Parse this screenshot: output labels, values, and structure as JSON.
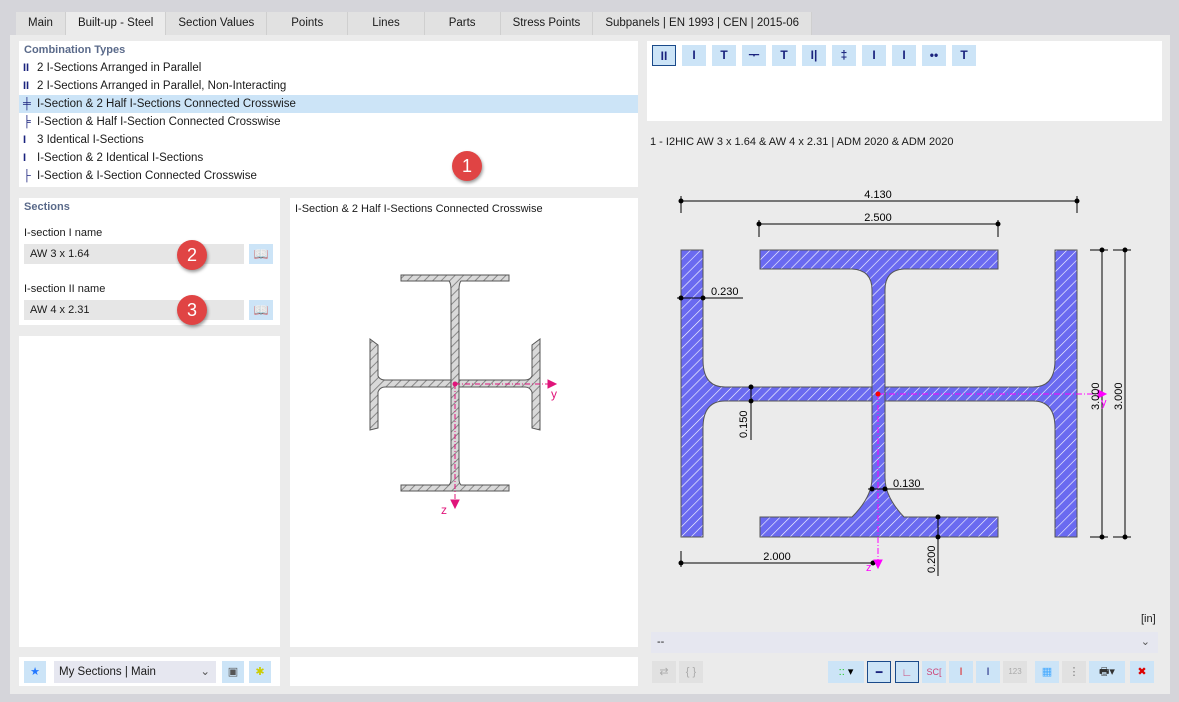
{
  "tabs": [
    "Main",
    "Built-up - Steel",
    "Section Values",
    "Points",
    "Lines",
    "Parts",
    "Stress Points",
    "Subpanels | EN 1993 | CEN | 2015-06"
  ],
  "active_tab": 1,
  "combination_types": {
    "title": "Combination Types",
    "items": [
      {
        "icon": "two-i-parallel-icon",
        "glyph": "II",
        "label": "2 I-Sections Arranged in Parallel"
      },
      {
        "icon": "two-i-parallel-noninteracting-icon",
        "glyph": "II",
        "label": "2 I-Sections Arranged in Parallel, Non-Interacting"
      },
      {
        "icon": "i-two-half-crosswise-icon",
        "glyph": "╪",
        "label": "I-Section & 2 Half I-Sections Connected Crosswise",
        "selected": true
      },
      {
        "icon": "i-half-crosswise-icon",
        "glyph": "╞",
        "label": "I-Section & Half I-Section Connected Crosswise"
      },
      {
        "icon": "three-identical-i-icon",
        "glyph": "I",
        "label": "3 Identical I-Sections"
      },
      {
        "icon": "i-two-identical-i-icon",
        "glyph": "I",
        "label": "I-Section & 2 Identical I-Sections"
      },
      {
        "icon": "i-i-crosswise-icon",
        "glyph": "├",
        "label": "I-Section & I-Section Connected Crosswise"
      }
    ]
  },
  "badges": [
    "1",
    "2",
    "3"
  ],
  "sections": {
    "title": "Sections",
    "section1_label": "I-section I name",
    "section1_value": "AW 3 x 1.64",
    "section2_label": "I-section II name",
    "section2_value": "AW 4 x 2.31"
  },
  "preview": {
    "title": "I-Section & 2 Half I-Sections Connected Crosswise",
    "axis_y": "y",
    "axis_z": "z"
  },
  "shape_toolbar": [
    {
      "icon": "double-i-icon",
      "glyph": "II",
      "selected": true
    },
    {
      "icon": "i-section-icon",
      "glyph": "I"
    },
    {
      "icon": "i-top-plate-icon",
      "glyph": "T"
    },
    {
      "icon": "half-t-icon",
      "glyph": "ᅮ"
    },
    {
      "icon": "double-t-icon",
      "glyph": "T"
    },
    {
      "icon": "i-plate-side-icon",
      "glyph": "I|"
    },
    {
      "icon": "i-cross-icon",
      "glyph": "‡"
    },
    {
      "icon": "i-narrow-icon",
      "glyph": "I"
    },
    {
      "icon": "i-dotted-icon",
      "glyph": "I"
    },
    {
      "icon": "two-bars-icon",
      "glyph": "••"
    },
    {
      "icon": "t-bar-icon",
      "glyph": "T"
    }
  ],
  "drawing": {
    "title": "1 - I2HIC AW 3 x 1.64 & AW 4 x 2.31 | ADM 2020 & ADM 2020",
    "dims": {
      "total_width": "4.130",
      "flange_width": "2.500",
      "flange_thk_half": "0.230",
      "web_thk_half": "0.150",
      "web_thk": "0.130",
      "flange_thk": "0.200",
      "offset": "2.000",
      "height1": "3.000",
      "height2": "3.000"
    },
    "axis_y": "y",
    "axis_z": "z",
    "unit": "[in]",
    "fill_color": "#6a6af0",
    "axis_color": "#ff00ff",
    "dropdown_value": "--"
  },
  "bottom_left": {
    "library_select": "My Sections | Main"
  },
  "bottom_right_buttons": [
    "points-icon",
    "dimension-icon",
    "axes-icon",
    "shear-center-icon",
    "stress-points-icon",
    "section-outline-icon",
    "numbering-icon",
    "grid-icon",
    "list-icon",
    "print-icon",
    "reset-view-icon"
  ]
}
